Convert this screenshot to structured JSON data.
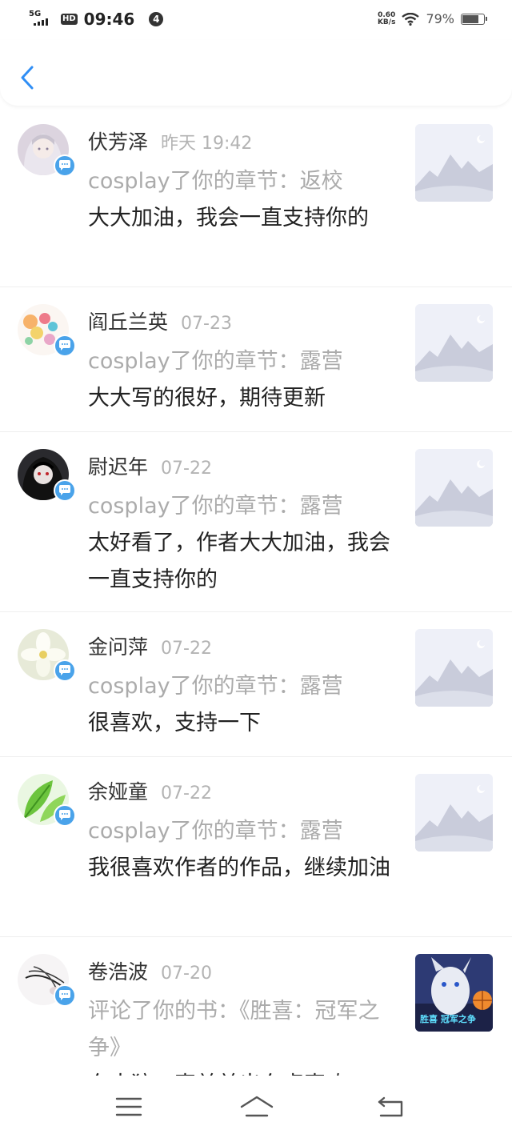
{
  "status": {
    "network": "5G",
    "hd": "HD",
    "time": "09:46",
    "notif_count": "4",
    "speed_value": "0.60",
    "speed_unit": "KB/s",
    "battery": "79%"
  },
  "items": [
    {
      "name": "伏芳泽",
      "time": "昨天 19:42",
      "action": "cosplay了你的章节：返校",
      "comment": "大大加油，我会一直支持你的"
    },
    {
      "name": "阎丘兰英",
      "time": "07-23",
      "action": "cosplay了你的章节：露营",
      "comment": "大大写的很好，期待更新"
    },
    {
      "name": "尉迟年",
      "time": "07-22",
      "action": "cosplay了你的章节：露营",
      "comment": "太好看了，作者大大加油，我会一直支持你的"
    },
    {
      "name": "金问萍",
      "time": "07-22",
      "action": "cosplay了你的章节：露营",
      "comment": "很喜欢，支持一下"
    },
    {
      "name": "余娅童",
      "time": "07-22",
      "action": "cosplay了你的章节：露营",
      "comment": "我很喜欢作者的作品，继续加油"
    },
    {
      "name": "卷浩波",
      "time": "07-20",
      "action": "评论了你的书：《胜喜：冠军之争》",
      "comment": "东大狼：喜羊羊出东卓喜欢"
    }
  ],
  "cover_text": "胜喜 冠军之争"
}
